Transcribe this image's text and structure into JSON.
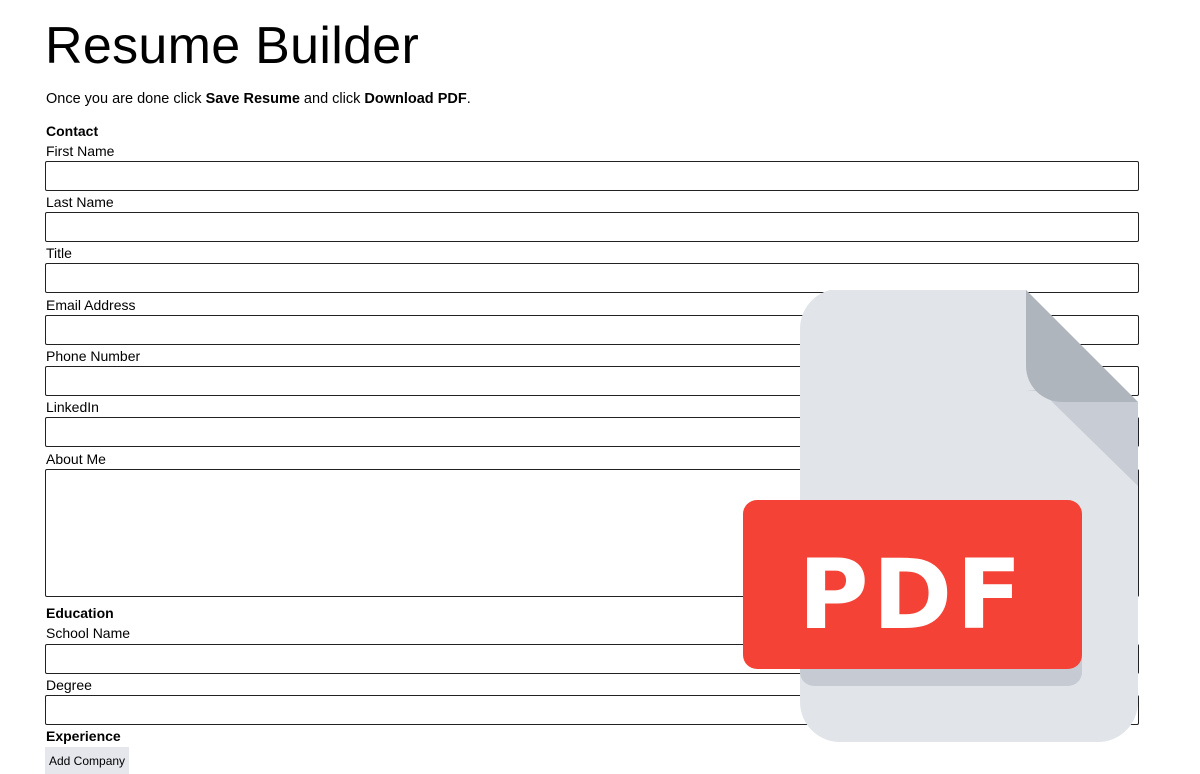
{
  "page": {
    "title": "Resume Builder",
    "intro": {
      "prefix": "Once you are done click ",
      "save_label": "Save Resume",
      "middle": " and click ",
      "download_label": "Download PDF",
      "suffix": "."
    }
  },
  "contact": {
    "heading": "Contact",
    "first_name": {
      "label": "First Name",
      "value": ""
    },
    "last_name": {
      "label": "Last Name",
      "value": ""
    },
    "title": {
      "label": "Title",
      "value": ""
    },
    "email": {
      "label": "Email Address",
      "value": ""
    },
    "phone": {
      "label": "Phone Number",
      "value": ""
    },
    "linkedin": {
      "label": "LinkedIn",
      "value": ""
    },
    "about": {
      "label": "About Me",
      "value": ""
    }
  },
  "education": {
    "heading": "Education",
    "school": {
      "label": "School Name",
      "value": ""
    },
    "degree": {
      "label": "Degree",
      "value": ""
    }
  },
  "experience": {
    "heading": "Experience",
    "add_button": "Add Company"
  },
  "overlay": {
    "icon": "pdf-file-icon",
    "badge_text": "PDF",
    "colors": {
      "page": "#e1e5e9",
      "fold": "#aeb5bd",
      "badge": "#f44336",
      "badge_shadow": "#c5cad3"
    }
  }
}
